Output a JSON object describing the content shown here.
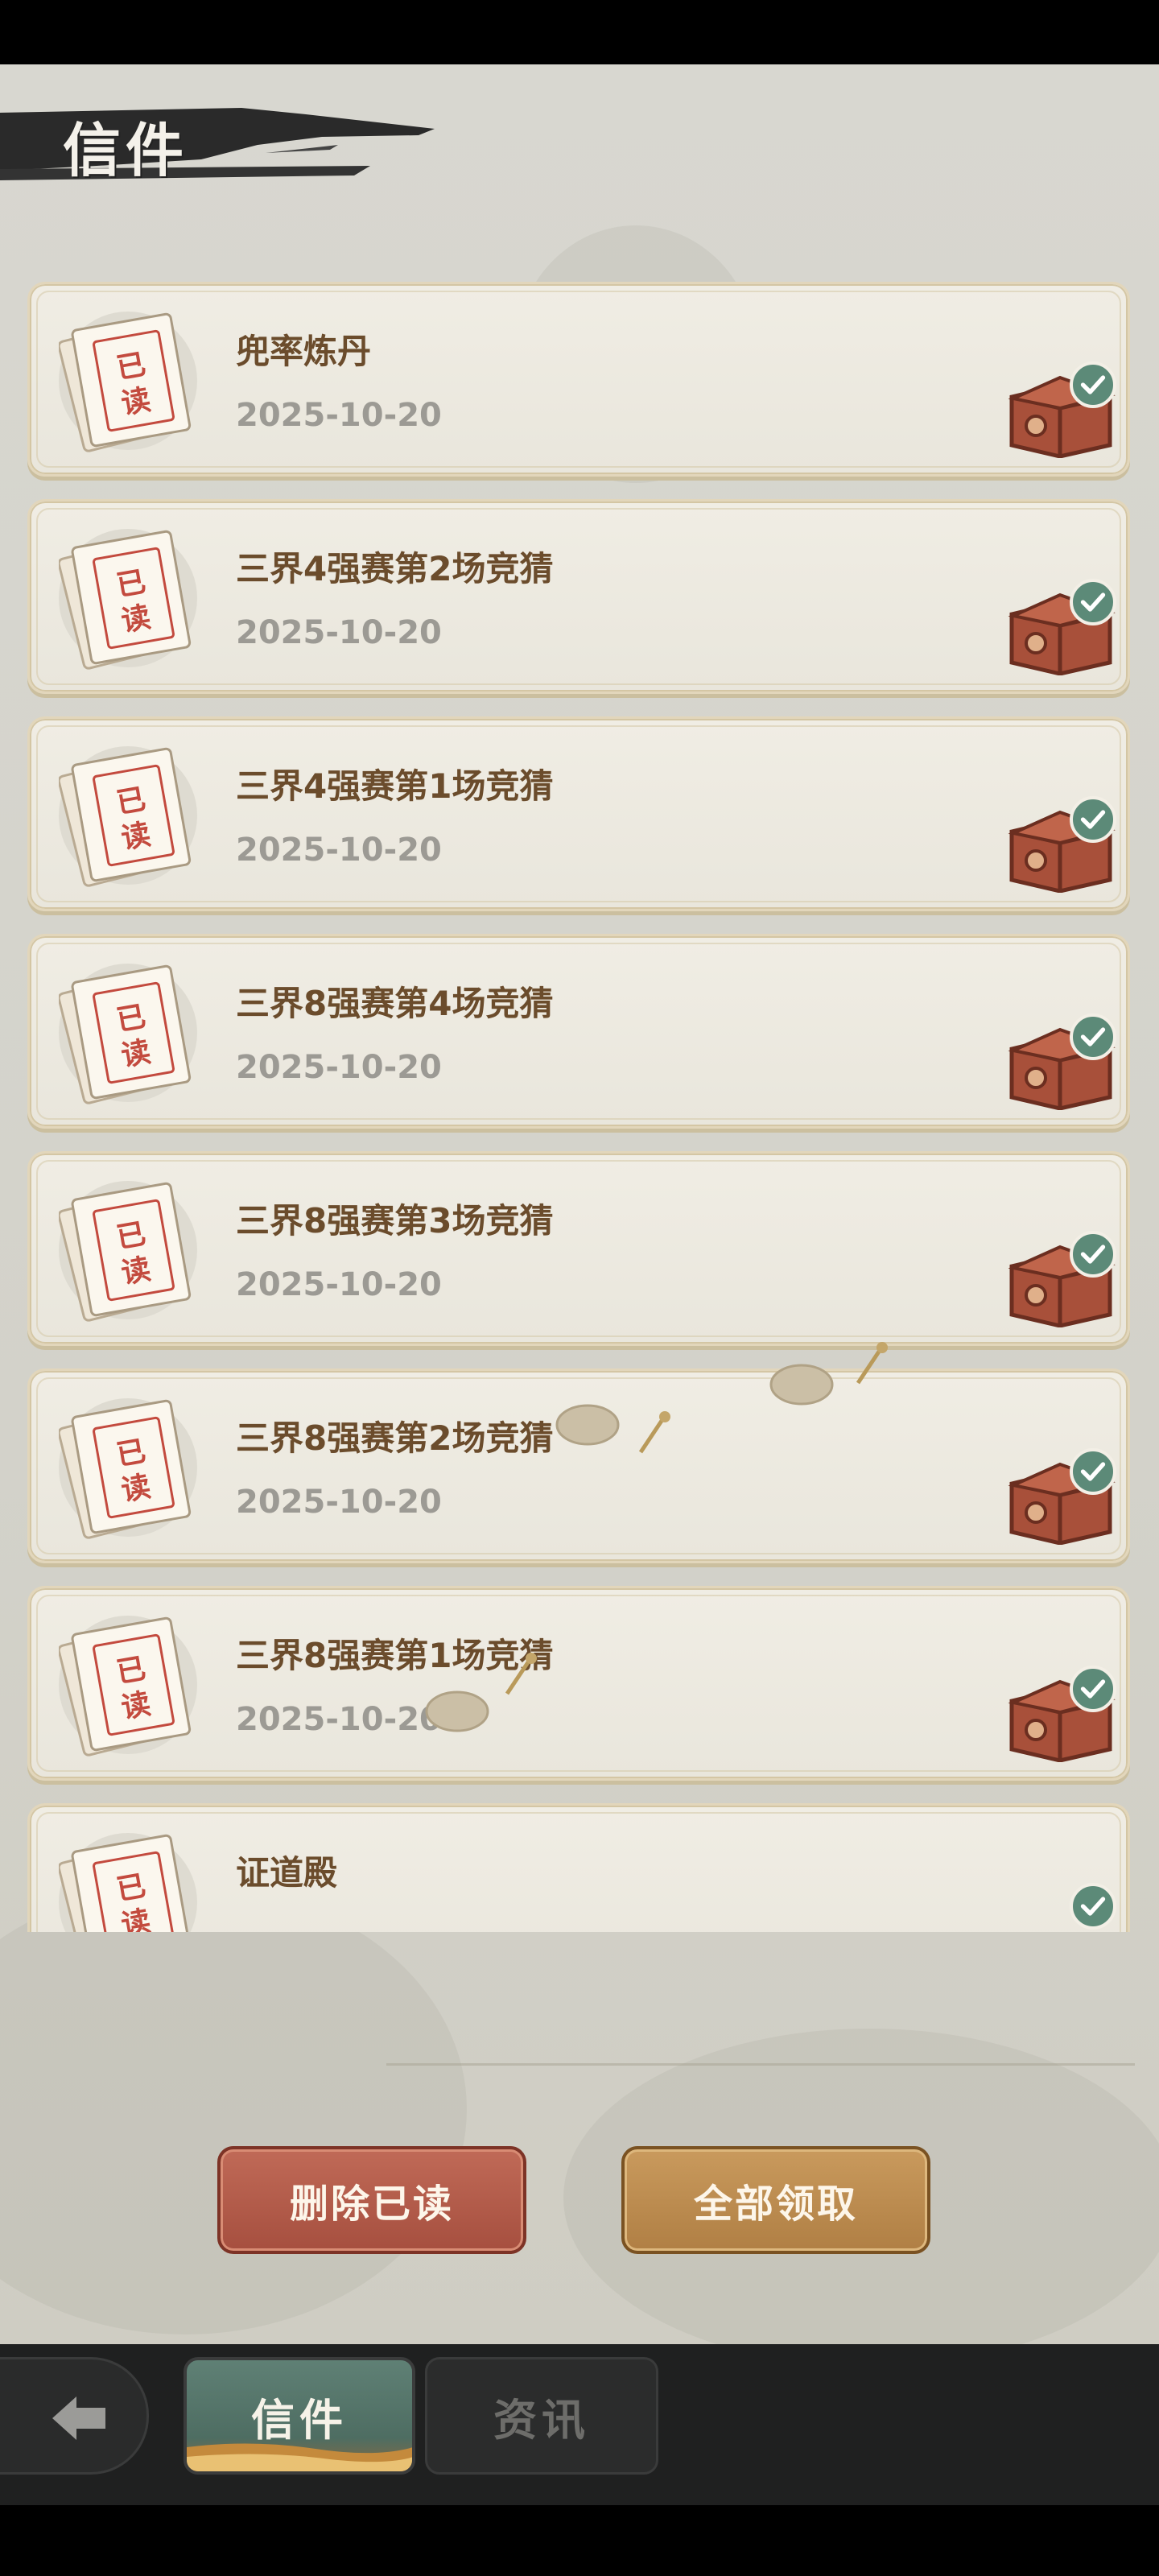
{
  "panel": {
    "title": "信件"
  },
  "mail": {
    "read_badge": [
      "已",
      "读"
    ],
    "items": [
      {
        "title": "兜率炼丹",
        "date": "2025-10-20"
      },
      {
        "title": "三界4强赛第2场竞猜",
        "date": "2025-10-20"
      },
      {
        "title": "三界4强赛第1场竞猜",
        "date": "2025-10-20"
      },
      {
        "title": "三界8强赛第4场竞猜",
        "date": "2025-10-20"
      },
      {
        "title": "三界8强赛第3场竞猜",
        "date": "2025-10-20"
      },
      {
        "title": "三界8强赛第2场竞猜",
        "date": "2025-10-20"
      },
      {
        "title": "三界8强赛第1场竞猜",
        "date": "2025-10-20"
      },
      {
        "title": "证道殿",
        "date": ""
      }
    ]
  },
  "actions": {
    "delete_read": "删除已读",
    "claim_all": "全部领取"
  },
  "nav": {
    "tabs": [
      {
        "label": "信件",
        "active": true
      },
      {
        "label": "资讯",
        "active": false
      }
    ]
  },
  "colors": {
    "title_brown": "#6b4c2c",
    "date_gray": "#9c9a94",
    "check_green": "#5c8a78",
    "delete_red": "#a64f3f",
    "claim_gold": "#b07f44"
  },
  "icons": {
    "letter": "read-letter-icon",
    "reward": "treasure-chest-icon",
    "claimed": "check-icon",
    "back": "back-arrow-icon"
  }
}
